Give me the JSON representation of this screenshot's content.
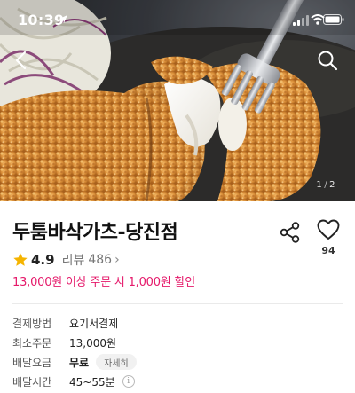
{
  "status_bar": {
    "time": "10:39",
    "location_icon": "location-arrow-icon",
    "signal_icon": "cellular-signal-icon",
    "wifi_icon": "wifi-icon",
    "battery_icon": "battery-icon"
  },
  "nav": {
    "back_icon": "chevron-left-icon",
    "search_icon": "search-icon"
  },
  "hero": {
    "image": "fried-pork-cutlet-photo",
    "page_current": "1",
    "page_separator": "/",
    "page_total": "2"
  },
  "store": {
    "name": "두툼바삭가츠-당진점",
    "share_icon": "share-icon",
    "like_icon": "heart-icon",
    "like_count": "94",
    "rating": "4.9",
    "review_label": "리뷰",
    "review_count": "486",
    "review_chevron": "›",
    "discount_text": "13,000원 이상 주문 시 1,000원 할인"
  },
  "details": {
    "payment": {
      "label": "결제방법",
      "value": "요기서결제"
    },
    "min_order": {
      "label": "최소주문",
      "value": "13,000원"
    },
    "delivery_fee": {
      "label": "배달요금",
      "value": "무료",
      "button": "자세히"
    },
    "delivery_time": {
      "label": "배달시간",
      "value": "45~55분",
      "info": "i"
    }
  },
  "colors": {
    "accent_pink": "#e5196a",
    "star": "#f5b400",
    "text_dark": "#111111",
    "text_muted": "#777777"
  }
}
